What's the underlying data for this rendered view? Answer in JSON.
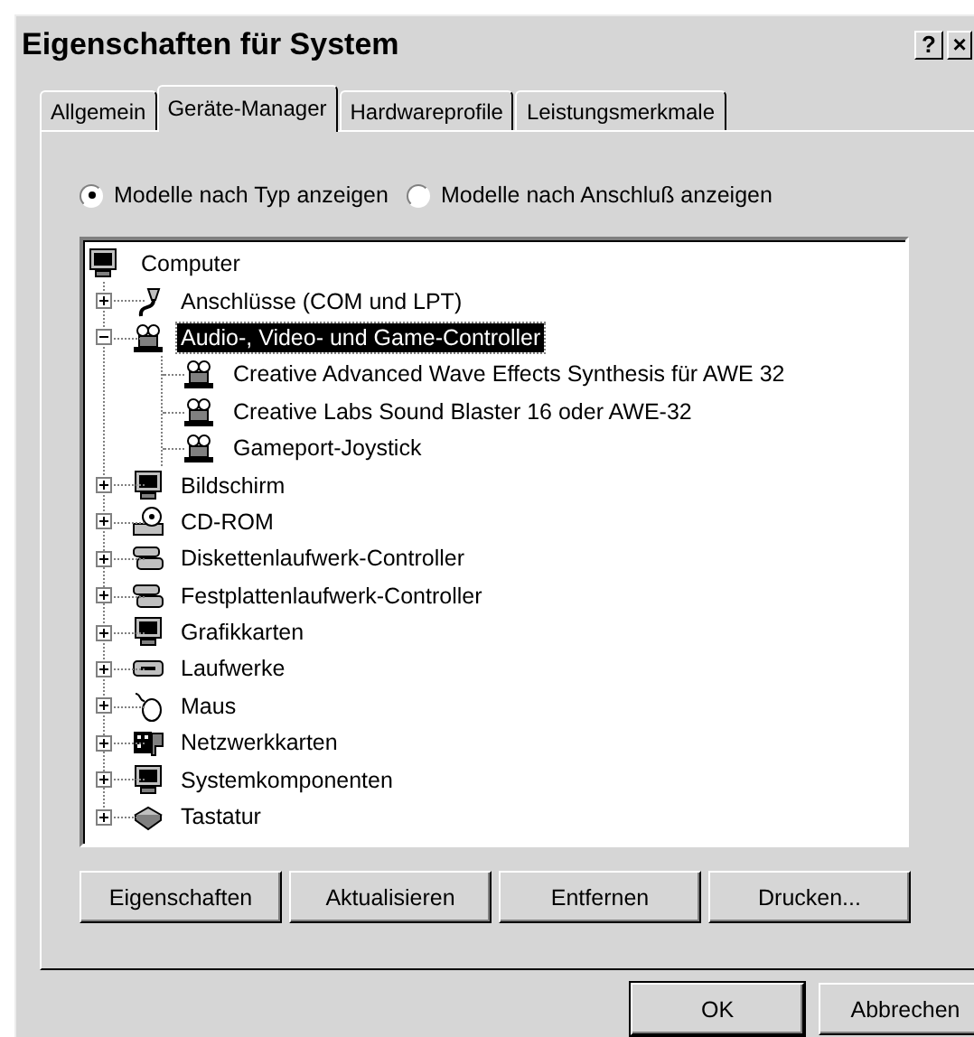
{
  "window": {
    "title": "Eigenschaften für System",
    "help": "?",
    "close": "×"
  },
  "tabs": [
    {
      "label": "Allgemein",
      "selected": false
    },
    {
      "label": "Geräte-Manager",
      "selected": true
    },
    {
      "label": "Hardwareprofile",
      "selected": false
    },
    {
      "label": "Leistungsmerkmale",
      "selected": false
    }
  ],
  "view_options": [
    {
      "label": "Modelle nach Typ anzeigen",
      "selected": true
    },
    {
      "label": "Modelle nach Anschluß anzeigen",
      "selected": false
    }
  ],
  "tree": {
    "label": "Computer",
    "children": [
      {
        "label": "Anschlüsse (COM und LPT)",
        "expanded": false,
        "selected": false
      },
      {
        "label": "Audio-, Video- und Game-Controller",
        "expanded": true,
        "selected": true,
        "children": [
          {
            "label": "Creative Advanced Wave Effects Synthesis für AWE 32",
            "selected": false
          },
          {
            "label": "Creative Labs Sound Blaster 16 oder AWE-32",
            "selected": false
          },
          {
            "label": "Gameport-Joystick",
            "selected": false
          }
        ]
      },
      {
        "label": "Bildschirm",
        "expanded": false,
        "selected": false
      },
      {
        "label": "CD-ROM",
        "expanded": false,
        "selected": false
      },
      {
        "label": "Diskettenlaufwerk-Controller",
        "expanded": false,
        "selected": false
      },
      {
        "label": "Festplattenlaufwerk-Controller",
        "expanded": false,
        "selected": false
      },
      {
        "label": "Grafikkarten",
        "expanded": false,
        "selected": false
      },
      {
        "label": "Laufwerke",
        "expanded": false,
        "selected": false
      },
      {
        "label": "Maus",
        "expanded": false,
        "selected": false
      },
      {
        "label": "Netzwerkkarten",
        "expanded": false,
        "selected": false
      },
      {
        "label": "Systemkomponenten",
        "expanded": false,
        "selected": false
      },
      {
        "label": "Tastatur",
        "expanded": false,
        "selected": false
      }
    ]
  },
  "panel_buttons": [
    "Eigenschaften",
    "Aktualisieren",
    "Entfernen",
    "Drucken..."
  ],
  "dialog_buttons": [
    {
      "label": "OK",
      "default": true
    },
    {
      "label": "Abbrechen",
      "default": false
    }
  ]
}
